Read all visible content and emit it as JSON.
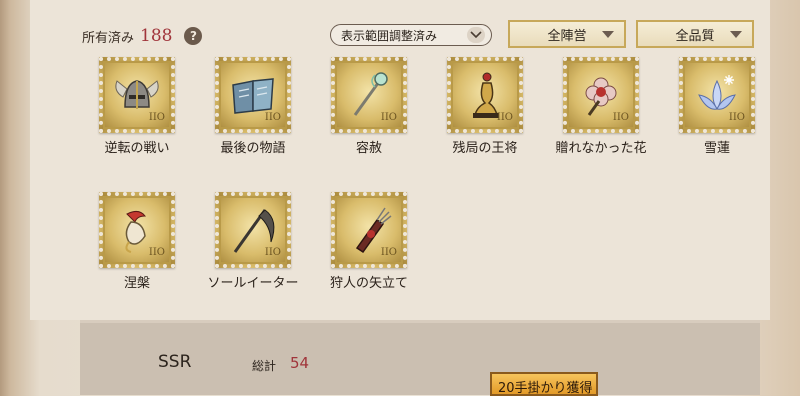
{
  "header": {
    "owned_label": "所有済み",
    "owned_count": "188",
    "help_glyph": "?",
    "filter_label": "表示範囲調整済み",
    "camp_dropdown": "全陣営",
    "quality_dropdown": "全品質"
  },
  "items": [
    {
      "label": "逆転の戦い",
      "icon": "winged-helmet-icon"
    },
    {
      "label": "最後の物語",
      "icon": "book-icon"
    },
    {
      "label": "容赦",
      "icon": "staff-icon"
    },
    {
      "label": "残局の王将",
      "icon": "chess-king-icon"
    },
    {
      "label": "贈れなかった花",
      "icon": "flower-icon"
    },
    {
      "label": "雪蓮",
      "icon": "snow-lotus-icon"
    },
    {
      "label": "涅槃",
      "icon": "phoenix-icon"
    },
    {
      "label": "ソールイーター",
      "icon": "scythe-icon"
    },
    {
      "label": "狩人の矢立て",
      "icon": "quiver-icon"
    }
  ],
  "stamp_mark": "IIO",
  "summary": {
    "rarity": "SSR",
    "total_label": "総計",
    "total_value": "54",
    "button_label": "20手掛かり獲得"
  },
  "colors": {
    "accent_red": "#a0343a",
    "gold": "#c7a85a",
    "button_orange": "#e39a28"
  }
}
